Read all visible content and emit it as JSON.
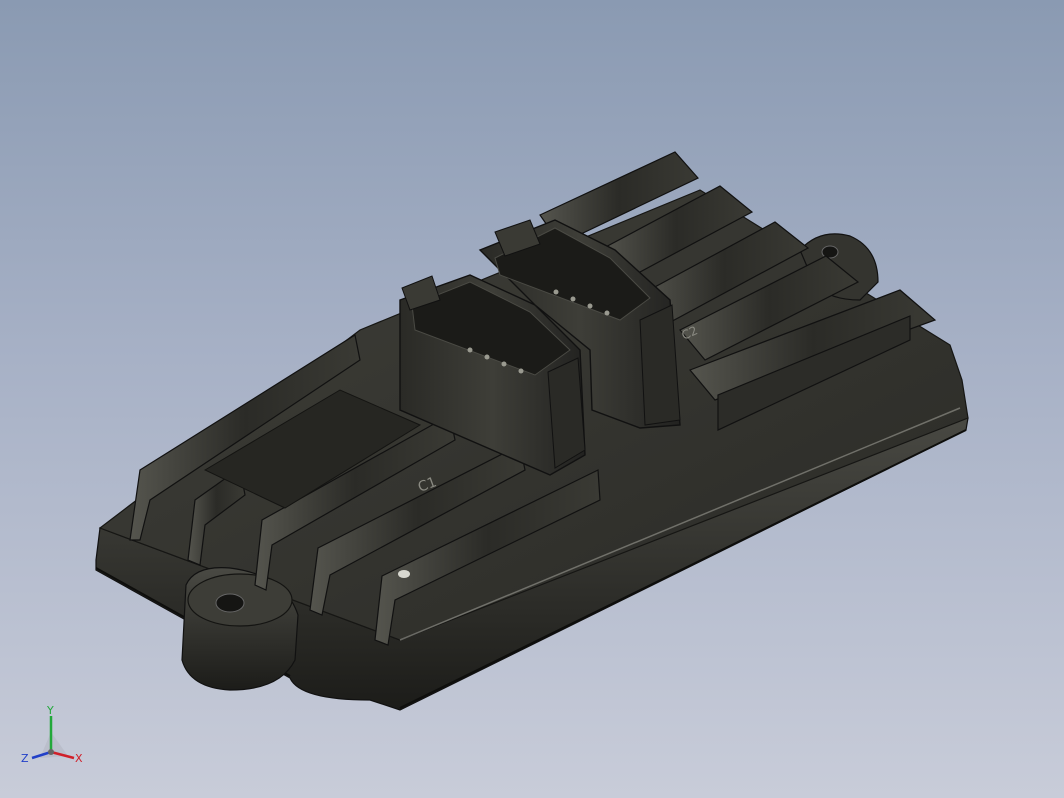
{
  "viewport": {
    "background_top": "#8a9ab2",
    "background_bottom": "#c8ccd9"
  },
  "model": {
    "part_color": "#2e2e29",
    "connector_labels": [
      "C1",
      "C2"
    ]
  },
  "triad": {
    "x_label": "X",
    "y_label": "Y",
    "z_label": "Z",
    "x_color": "#d0202a",
    "y_color": "#22a83a",
    "z_color": "#2240c8"
  }
}
